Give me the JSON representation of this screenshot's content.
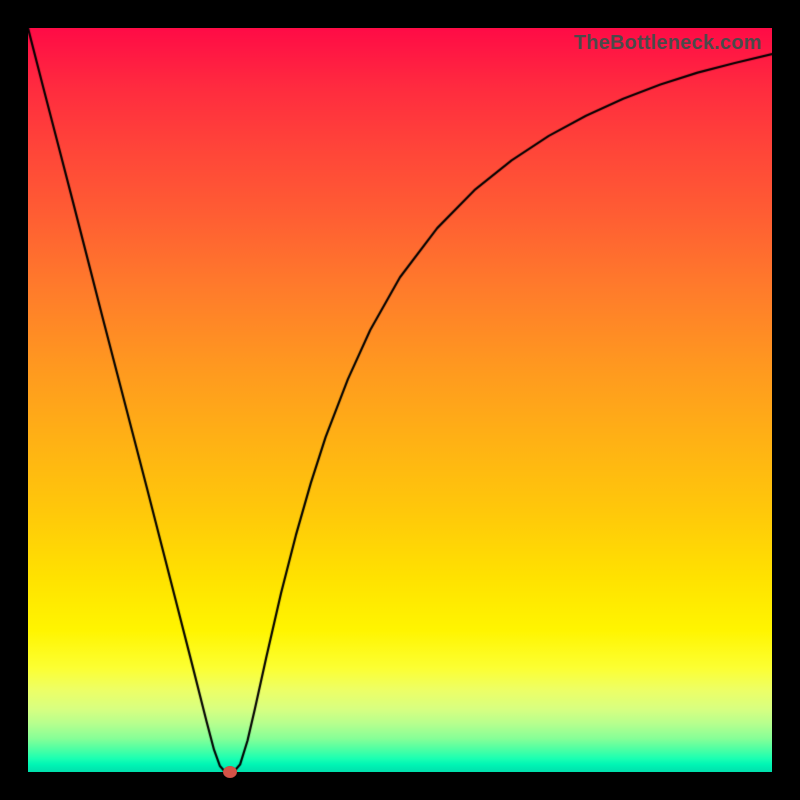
{
  "watermark": "TheBottleneck.com",
  "chart_data": {
    "type": "line",
    "title": "",
    "xlabel": "",
    "ylabel": "",
    "xlim": [
      0,
      1
    ],
    "ylim": [
      0,
      1
    ],
    "grid": false,
    "legend": false,
    "background": "vertical-gradient red→orange→yellow→green",
    "series": [
      {
        "name": "bottleneck-curve",
        "x": [
          0.0,
          0.02,
          0.04,
          0.06,
          0.08,
          0.1,
          0.12,
          0.14,
          0.16,
          0.18,
          0.2,
          0.22,
          0.24,
          0.25,
          0.258,
          0.265,
          0.272,
          0.278,
          0.285,
          0.295,
          0.305,
          0.32,
          0.34,
          0.36,
          0.38,
          0.4,
          0.43,
          0.46,
          0.5,
          0.55,
          0.6,
          0.65,
          0.7,
          0.75,
          0.8,
          0.85,
          0.9,
          0.95,
          1.0
        ],
        "values": [
          1.0,
          0.922,
          0.845,
          0.768,
          0.69,
          0.612,
          0.535,
          0.458,
          0.381,
          0.303,
          0.225,
          0.147,
          0.068,
          0.03,
          0.008,
          0.0,
          0.0,
          0.002,
          0.01,
          0.042,
          0.085,
          0.153,
          0.24,
          0.318,
          0.388,
          0.45,
          0.528,
          0.594,
          0.665,
          0.731,
          0.782,
          0.822,
          0.855,
          0.882,
          0.905,
          0.924,
          0.94,
          0.953,
          0.965
        ]
      }
    ],
    "marker": {
      "x": 0.272,
      "y": 0.0
    },
    "gradient_stops": [
      {
        "pos": 0.0,
        "color": "#ff0b46"
      },
      {
        "pos": 0.5,
        "color": "#ffa818"
      },
      {
        "pos": 0.8,
        "color": "#fff500"
      },
      {
        "pos": 1.0,
        "color": "#00dfad"
      }
    ]
  }
}
